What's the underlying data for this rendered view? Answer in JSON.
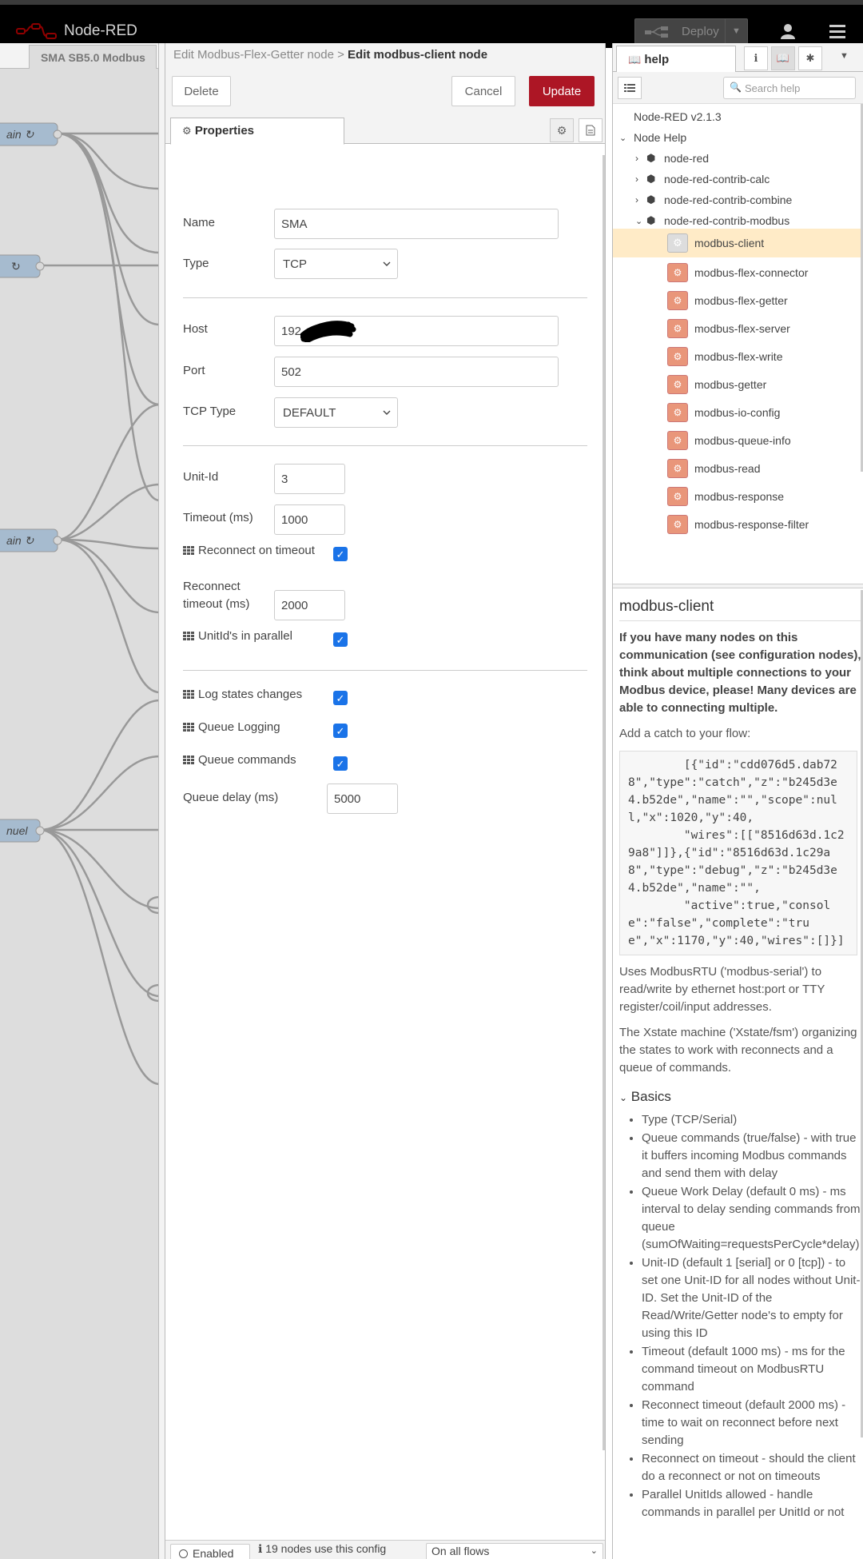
{
  "header": {
    "title": "Node-RED",
    "deploy_label": "Deploy"
  },
  "workspace": {
    "tab_label": "SMA SB5.0 Modbus",
    "node_labels": [
      "ain ↻",
      "↻",
      "ain ↻",
      "nuel"
    ]
  },
  "tray": {
    "breadcrumb_parent": "Edit Modbus-Flex-Getter node",
    "breadcrumb_sep": ">",
    "breadcrumb_current": "Edit modbus-client node",
    "delete_label": "Delete",
    "cancel_label": "Cancel",
    "update_label": "Update",
    "tab_properties": "Properties",
    "fields": {
      "name_label": "Name",
      "name_value": "SMA",
      "type_label": "Type",
      "type_value": "TCP",
      "host_label": "Host",
      "host_value": "192",
      "port_label": "Port",
      "port_value": "502",
      "tcp_type_label": "TCP Type",
      "tcp_type_value": "DEFAULT",
      "unit_id_label": "Unit-Id",
      "unit_id_value": "3",
      "timeout_label": "Timeout (ms)",
      "timeout_value": "1000",
      "reconnect_on_timeout_label": "Reconnect on timeout",
      "reconnect_timeout_label_1": "Reconnect",
      "reconnect_timeout_label_2": "timeout (ms)",
      "reconnect_timeout_value": "2000",
      "unitids_parallel_label": "UnitId's in parallel",
      "log_states_label": "Log states changes",
      "queue_logging_label": "Queue Logging",
      "queue_commands_label": "Queue commands",
      "queue_delay_label": "Queue delay (ms)",
      "queue_delay_value": "5000"
    },
    "footer": {
      "enabled_label": "Enabled",
      "usage_text": "19 nodes use this config",
      "scope_value": "On all flows"
    }
  },
  "sidebar": {
    "tab_help": "help",
    "search_placeholder": "Search help",
    "tree": {
      "version": "Node-RED v2.1.3",
      "node_help": "Node Help",
      "packages": [
        "node-red",
        "node-red-contrib-calc",
        "node-red-contrib-combine",
        "node-red-contrib-modbus"
      ],
      "nodes": [
        "modbus-client",
        "modbus-flex-connector",
        "modbus-flex-getter",
        "modbus-flex-server",
        "modbus-flex-write",
        "modbus-getter",
        "modbus-io-config",
        "modbus-queue-info",
        "modbus-read",
        "modbus-response",
        "modbus-response-filter"
      ]
    },
    "help": {
      "title": "modbus-client",
      "intro_bold": "If you have many nodes on this communication (see configuration nodes), think about multiple connections to your Modbus device, please! Many devices are able to connecting multiple.",
      "catch_text": "Add a catch to your flow:",
      "code": "        [{\"id\":\"cdd076d5.dab728\",\"type\":\"catch\",\"z\":\"b245d3e4.b52de\",\"name\":\"\",\"scope\":null,\"x\":1020,\"y\":40,\n        \"wires\":[[\"8516d63d.1c29a8\"]]},{\"id\":\"8516d63d.1c29a8\",\"type\":\"debug\",\"z\":\"b245d3e4.b52de\",\"name\":\"\",\n        \"active\":true,\"console\":\"false\",\"complete\":\"true\",\"x\":1170,\"y\":40,\"wires\":[]}]",
      "uses_text": "Uses ModbusRTU ('modbus-serial') to read/write by ethernet host:port or TTY register/coil/input addresses.",
      "xstate_text": "The Xstate machine ('Xstate/fsm') organizing the states to work with reconnects and a queue of commands.",
      "basics_title": "Basics",
      "basics": [
        "Type (TCP/Serial)",
        "Queue commands (true/false) - with true it buffers incoming Modbus commands and send them with delay",
        "Queue Work Delay (default 0 ms) - ms interval to delay sending commands from queue (sumOfWaiting=requestsPerCycle*delay)",
        "Unit-ID (default 1 [serial] or 0 [tcp]) - to set one Unit-ID for all nodes without Unit-ID. Set the Unit-ID of the Read/Write/Getter node's to empty for using this ID",
        "Timeout (default 1000 ms) - ms for the command timeout on ModbusRTU command",
        "Reconnect timeout (default 2000 ms) - time to wait on reconnect before next sending",
        "Reconnect on timeout - should the client do a reconnect or not on timeouts",
        "Parallel UnitIds allowed - handle commands in parallel per UnitId or not"
      ]
    }
  }
}
